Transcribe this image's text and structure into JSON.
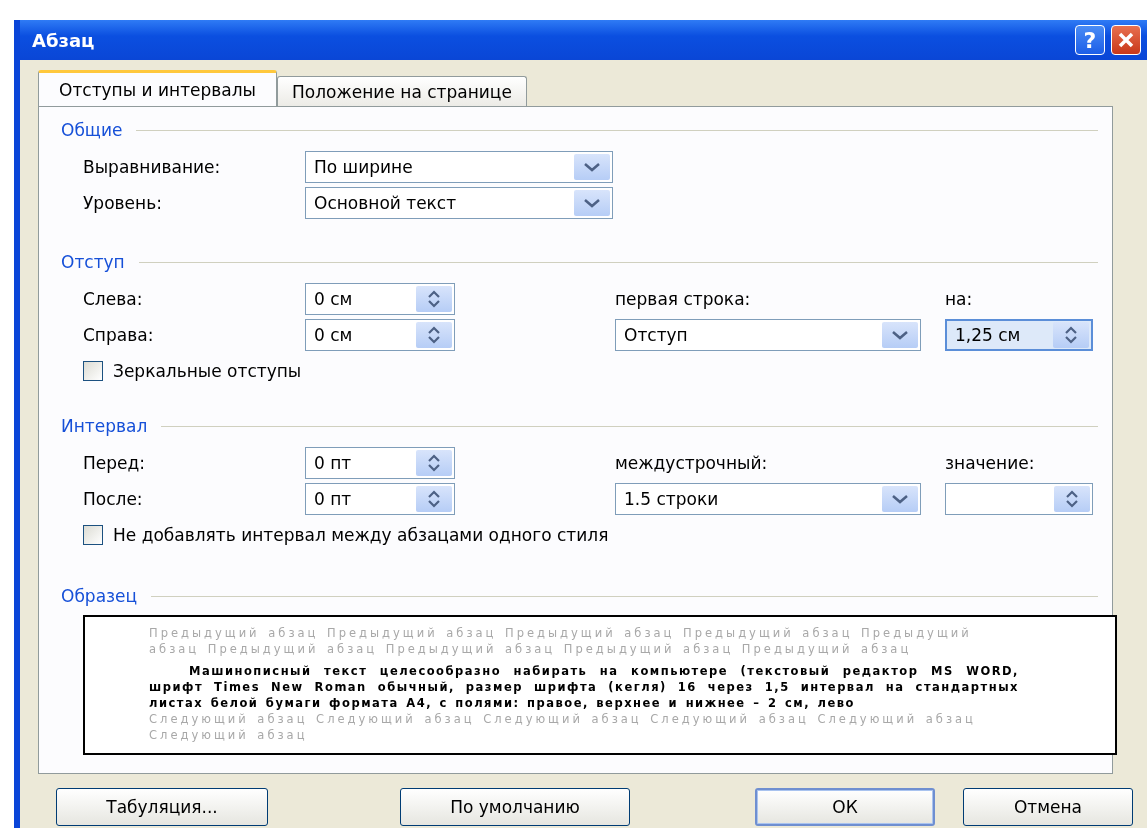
{
  "window": {
    "title": "Абзац",
    "help": "?"
  },
  "tabs": [
    {
      "label": "Отступы и интервалы",
      "selected": true
    },
    {
      "label": "Положение на странице",
      "selected": false
    }
  ],
  "general": {
    "heading": "Общие",
    "fields": [
      {
        "label": "Выравнивание:",
        "value": "По ширине"
      },
      {
        "label": "Уровень:",
        "value": "Основной текст"
      }
    ]
  },
  "indent": {
    "heading": "Отступ",
    "left": {
      "label": "Слева:",
      "value": "0 см"
    },
    "right": {
      "label": "Справа:",
      "value": "0 см"
    },
    "special": {
      "label": "первая строка:",
      "value": "Отступ"
    },
    "by": {
      "label": "на:",
      "value": "1,25 см"
    },
    "mirror": {
      "label": "Зеркальные отступы",
      "checked": false
    }
  },
  "spacing": {
    "heading": "Интервал",
    "before": {
      "label": "Перед:",
      "value": "0 пт"
    },
    "after": {
      "label": "После:",
      "value": "0 пт"
    },
    "line": {
      "label": "междустрочный:",
      "value": "1.5 строки"
    },
    "at": {
      "label": "значение:"
    },
    "no_space": {
      "label": "Не добавлять интервал между абзацами одного стиля",
      "checked": false
    }
  },
  "preview": {
    "heading": "Образец",
    "previous": "Предыдущий абзац Предыдущий абзац Предыдущий абзац Предыдущий абзац Предыдущий абзац Предыдущий абзац Предыдущий абзац Предыдущий абзац Предыдущий абзац",
    "text": "Машинописный текст целесообразно набирать на компьютере (текстовый редактор MS WORD, шрифт Times New Roman обычный, размер шрифта (кегля) 16 через 1,5 интервал на стандартных листах белой бумаги формата A4, с полями: правое, верхнее и нижнее – 2 см, лево",
    "next": "Следующий абзац Следующий абзац Следующий абзац Следующий абзац Следующий абзац Следующий абзац"
  },
  "buttons": [
    {
      "label": "Табуляция...",
      "default": false
    },
    {
      "label": "По умолчанию",
      "default": false
    },
    {
      "label": "ОК",
      "default": true
    },
    {
      "label": "Отмена",
      "default": false
    }
  ]
}
